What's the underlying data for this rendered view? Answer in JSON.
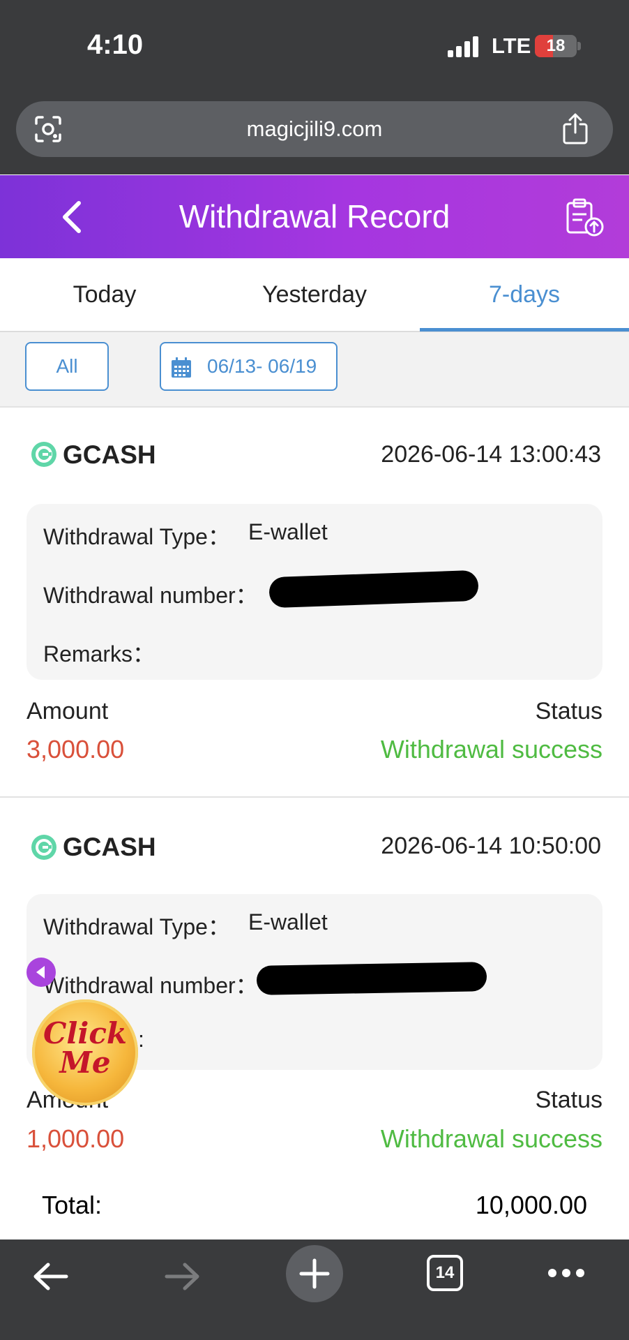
{
  "status_bar": {
    "time": "4:10",
    "network": "LTE",
    "battery": "18"
  },
  "browser": {
    "url": "magicjili9.com",
    "tab_count": "14"
  },
  "header": {
    "title": "Withdrawal Record"
  },
  "tabs": [
    {
      "label": "Today"
    },
    {
      "label": "Yesterday"
    },
    {
      "label": "7-days",
      "active": true
    }
  ],
  "filters": {
    "all_label": "All",
    "date_range": "06/13- 06/19"
  },
  "records": [
    {
      "method": "GCASH",
      "time": "2026-06-14 13:00:43",
      "type_label": "Withdrawal Type：",
      "type_value": "E-wallet",
      "number_label": "Withdrawal number：",
      "remarks_label": "Remarks：",
      "amount_label": "Amount",
      "amount": "3,000.00",
      "status_label": "Status",
      "status": "Withdrawal success"
    },
    {
      "method": "GCASH",
      "time": "2026-06-14 10:50:00",
      "type_label": "Withdrawal Type：",
      "type_value": "E-wallet",
      "number_label": "Withdrawal number：",
      "remarks_label": ":",
      "amount_label": "Amount",
      "amount": "1,000.00",
      "status_label": "Status",
      "status": "Withdrawal success"
    }
  ],
  "total": {
    "label": "Total:",
    "value": "10,000.00"
  },
  "promo": {
    "text": "Click Me"
  },
  "colors": {
    "accent": "#4a8fd1",
    "header_start": "#7d32d8",
    "header_end": "#b23cd9",
    "amount": "#d9503a",
    "success": "#4fbb42"
  }
}
